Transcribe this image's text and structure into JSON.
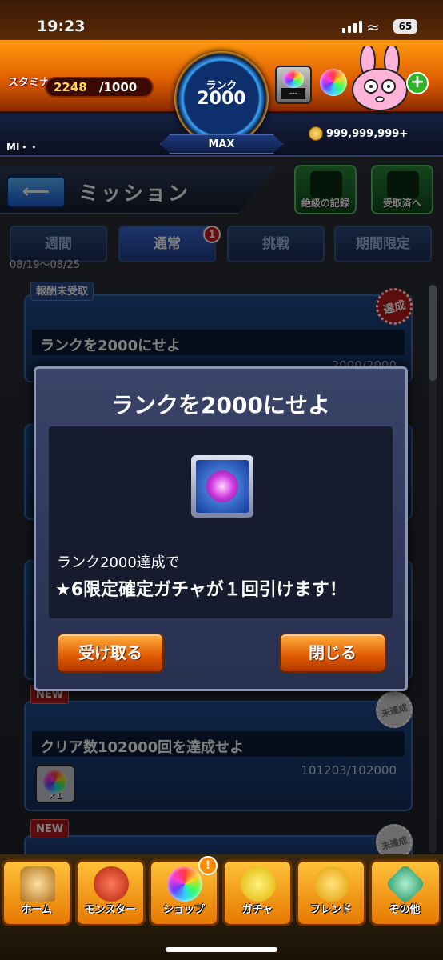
{
  "status": {
    "time": "19:23",
    "battery": "65"
  },
  "header": {
    "stamina_label": "スタミナ",
    "stamina_value": "2248",
    "stamina_max": "/1000",
    "rank_label": "ランク",
    "rank_value": "2000",
    "rank_max": "MAX",
    "player_name": "MI・・",
    "coins": "999,999,999+",
    "orb_box_text": "---"
  },
  "page": {
    "title": "ミッション",
    "back_icon": "back-arrow-icon"
  },
  "side_buttons": [
    {
      "label": "絶級の記録"
    },
    {
      "label": "受取済へ"
    }
  ],
  "tabs": [
    {
      "label": "週間"
    },
    {
      "label": "通常",
      "badge": "1"
    },
    {
      "label": "挑戦"
    },
    {
      "label": "期間限定"
    }
  ],
  "date_range": "08/19〜08/25",
  "missions": [
    {
      "tag": "報酬未受取",
      "title": "ランクを2000にせよ",
      "progress": "2000/2000",
      "stamp": "達成"
    },
    {
      "tag": "NEW",
      "title": "クリア数102000回を達成せよ",
      "progress": "101203/102000",
      "stamp": "未達成",
      "reward_count": "×1"
    },
    {
      "tag": "NEW",
      "stamp": "未達成"
    }
  ],
  "modal": {
    "title": "ランクを2000にせよ",
    "desc_line1": "ランク2000達成で",
    "desc_line2": "★6限定確定ガチャが１回引けます！",
    "receive_label": "受け取る",
    "close_label": "閉じる"
  },
  "nav": [
    {
      "label": "ホーム",
      "icon": "home-icon"
    },
    {
      "label": "モンスター",
      "icon": "monster-icon"
    },
    {
      "label": "ショップ",
      "icon": "shop-icon",
      "alert": "!"
    },
    {
      "label": "ガチャ",
      "icon": "gacha-icon"
    },
    {
      "label": "フレンド",
      "icon": "friend-icon"
    },
    {
      "label": "その他",
      "icon": "other-icon"
    }
  ]
}
